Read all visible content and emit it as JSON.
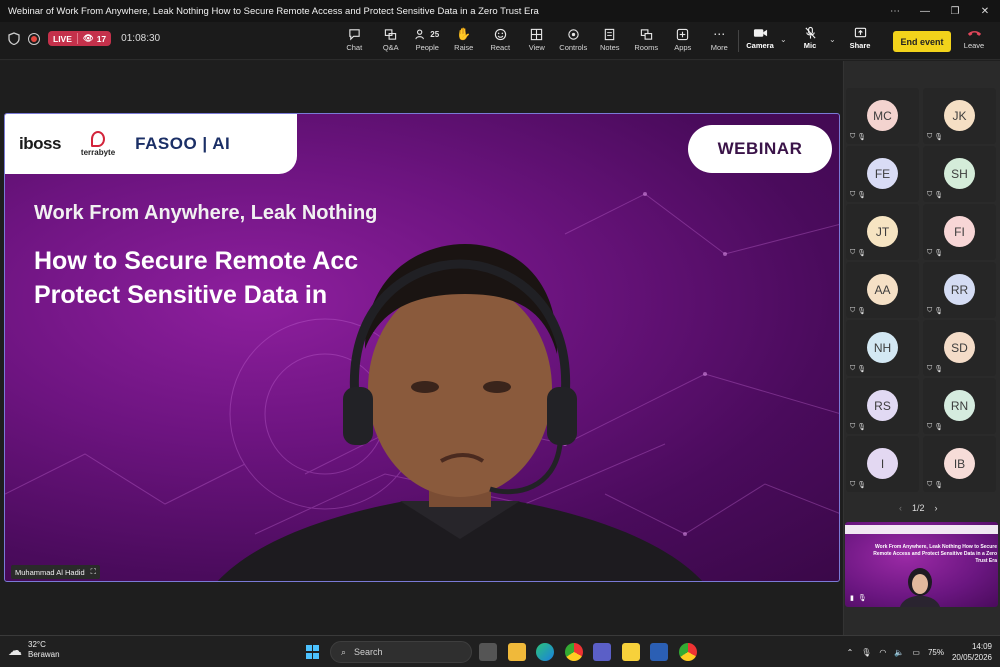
{
  "window": {
    "title": "Webinar of Work From Anywhere, Leak Nothing How to Secure Remote Access and Protect Sensitive Data in a Zero Trust Era"
  },
  "toolbar": {
    "live_label": "LIVE",
    "viewer_count": "17",
    "elapsed": "01:08:30",
    "people_count": "25",
    "items": [
      {
        "label": "Chat",
        "icon": "chat-icon"
      },
      {
        "label": "Q&A",
        "icon": "qa-icon"
      },
      {
        "label": "People",
        "icon": "people-icon"
      },
      {
        "label": "Raise",
        "icon": "raise-hand-icon"
      },
      {
        "label": "React",
        "icon": "react-icon"
      },
      {
        "label": "View",
        "icon": "view-icon"
      },
      {
        "label": "Controls",
        "icon": "controls-icon"
      },
      {
        "label": "Notes",
        "icon": "notes-icon"
      },
      {
        "label": "Rooms",
        "icon": "rooms-icon"
      },
      {
        "label": "Apps",
        "icon": "apps-icon"
      },
      {
        "label": "More",
        "icon": "more-icon"
      }
    ],
    "camera_label": "Camera",
    "mic_label": "Mic",
    "share_label": "Share",
    "end_event_label": "End event",
    "leave_label": "Leave"
  },
  "slide": {
    "logo_iboss": "iboss",
    "logo_terrabyte": "terrabyte",
    "logo_fasoo": "FASOO | AI",
    "badge": "WEBINAR",
    "subtitle": "Work From Anywhere, Leak Nothing",
    "title_line1": "How to Secure Remote Acc         nd",
    "title_line2": "Protect Sensitive Data in            ust Era"
  },
  "speaker_name": "Muhammad Al Hadid",
  "participants": [
    {
      "initials": "MC",
      "color": "#f3d3cf"
    },
    {
      "initials": "JK",
      "color": "#f5dfc4"
    },
    {
      "initials": "FE",
      "color": "#d9dcf5"
    },
    {
      "initials": "SH",
      "color": "#d4ecd9"
    },
    {
      "initials": "JT",
      "color": "#f6e4c2"
    },
    {
      "initials": "FI",
      "color": "#f7d6d6"
    },
    {
      "initials": "AA",
      "color": "#f5e0c6"
    },
    {
      "initials": "RR",
      "color": "#d4dcf3"
    },
    {
      "initials": "NH",
      "color": "#d3e8f3"
    },
    {
      "initials": "SD",
      "color": "#f4dcc8"
    },
    {
      "initials": "RS",
      "color": "#e1d9f3"
    },
    {
      "initials": "RN",
      "color": "#d5ecdf"
    },
    {
      "initials": "I",
      "color": "#e3d8f2"
    },
    {
      "initials": "IB",
      "color": "#f6dcd8"
    }
  ],
  "pager": "1/2",
  "selfview": {
    "text": "Work From Anywhere, Leak Nothing How to Secure Remote Access and Protect Sensitive Data in a Zero Trust Era"
  },
  "taskbar": {
    "temperature": "32°C",
    "weather_text": "Berawan",
    "search_placeholder": "Search",
    "battery": "75%",
    "time": "14:09",
    "date": "20/05/2026"
  }
}
